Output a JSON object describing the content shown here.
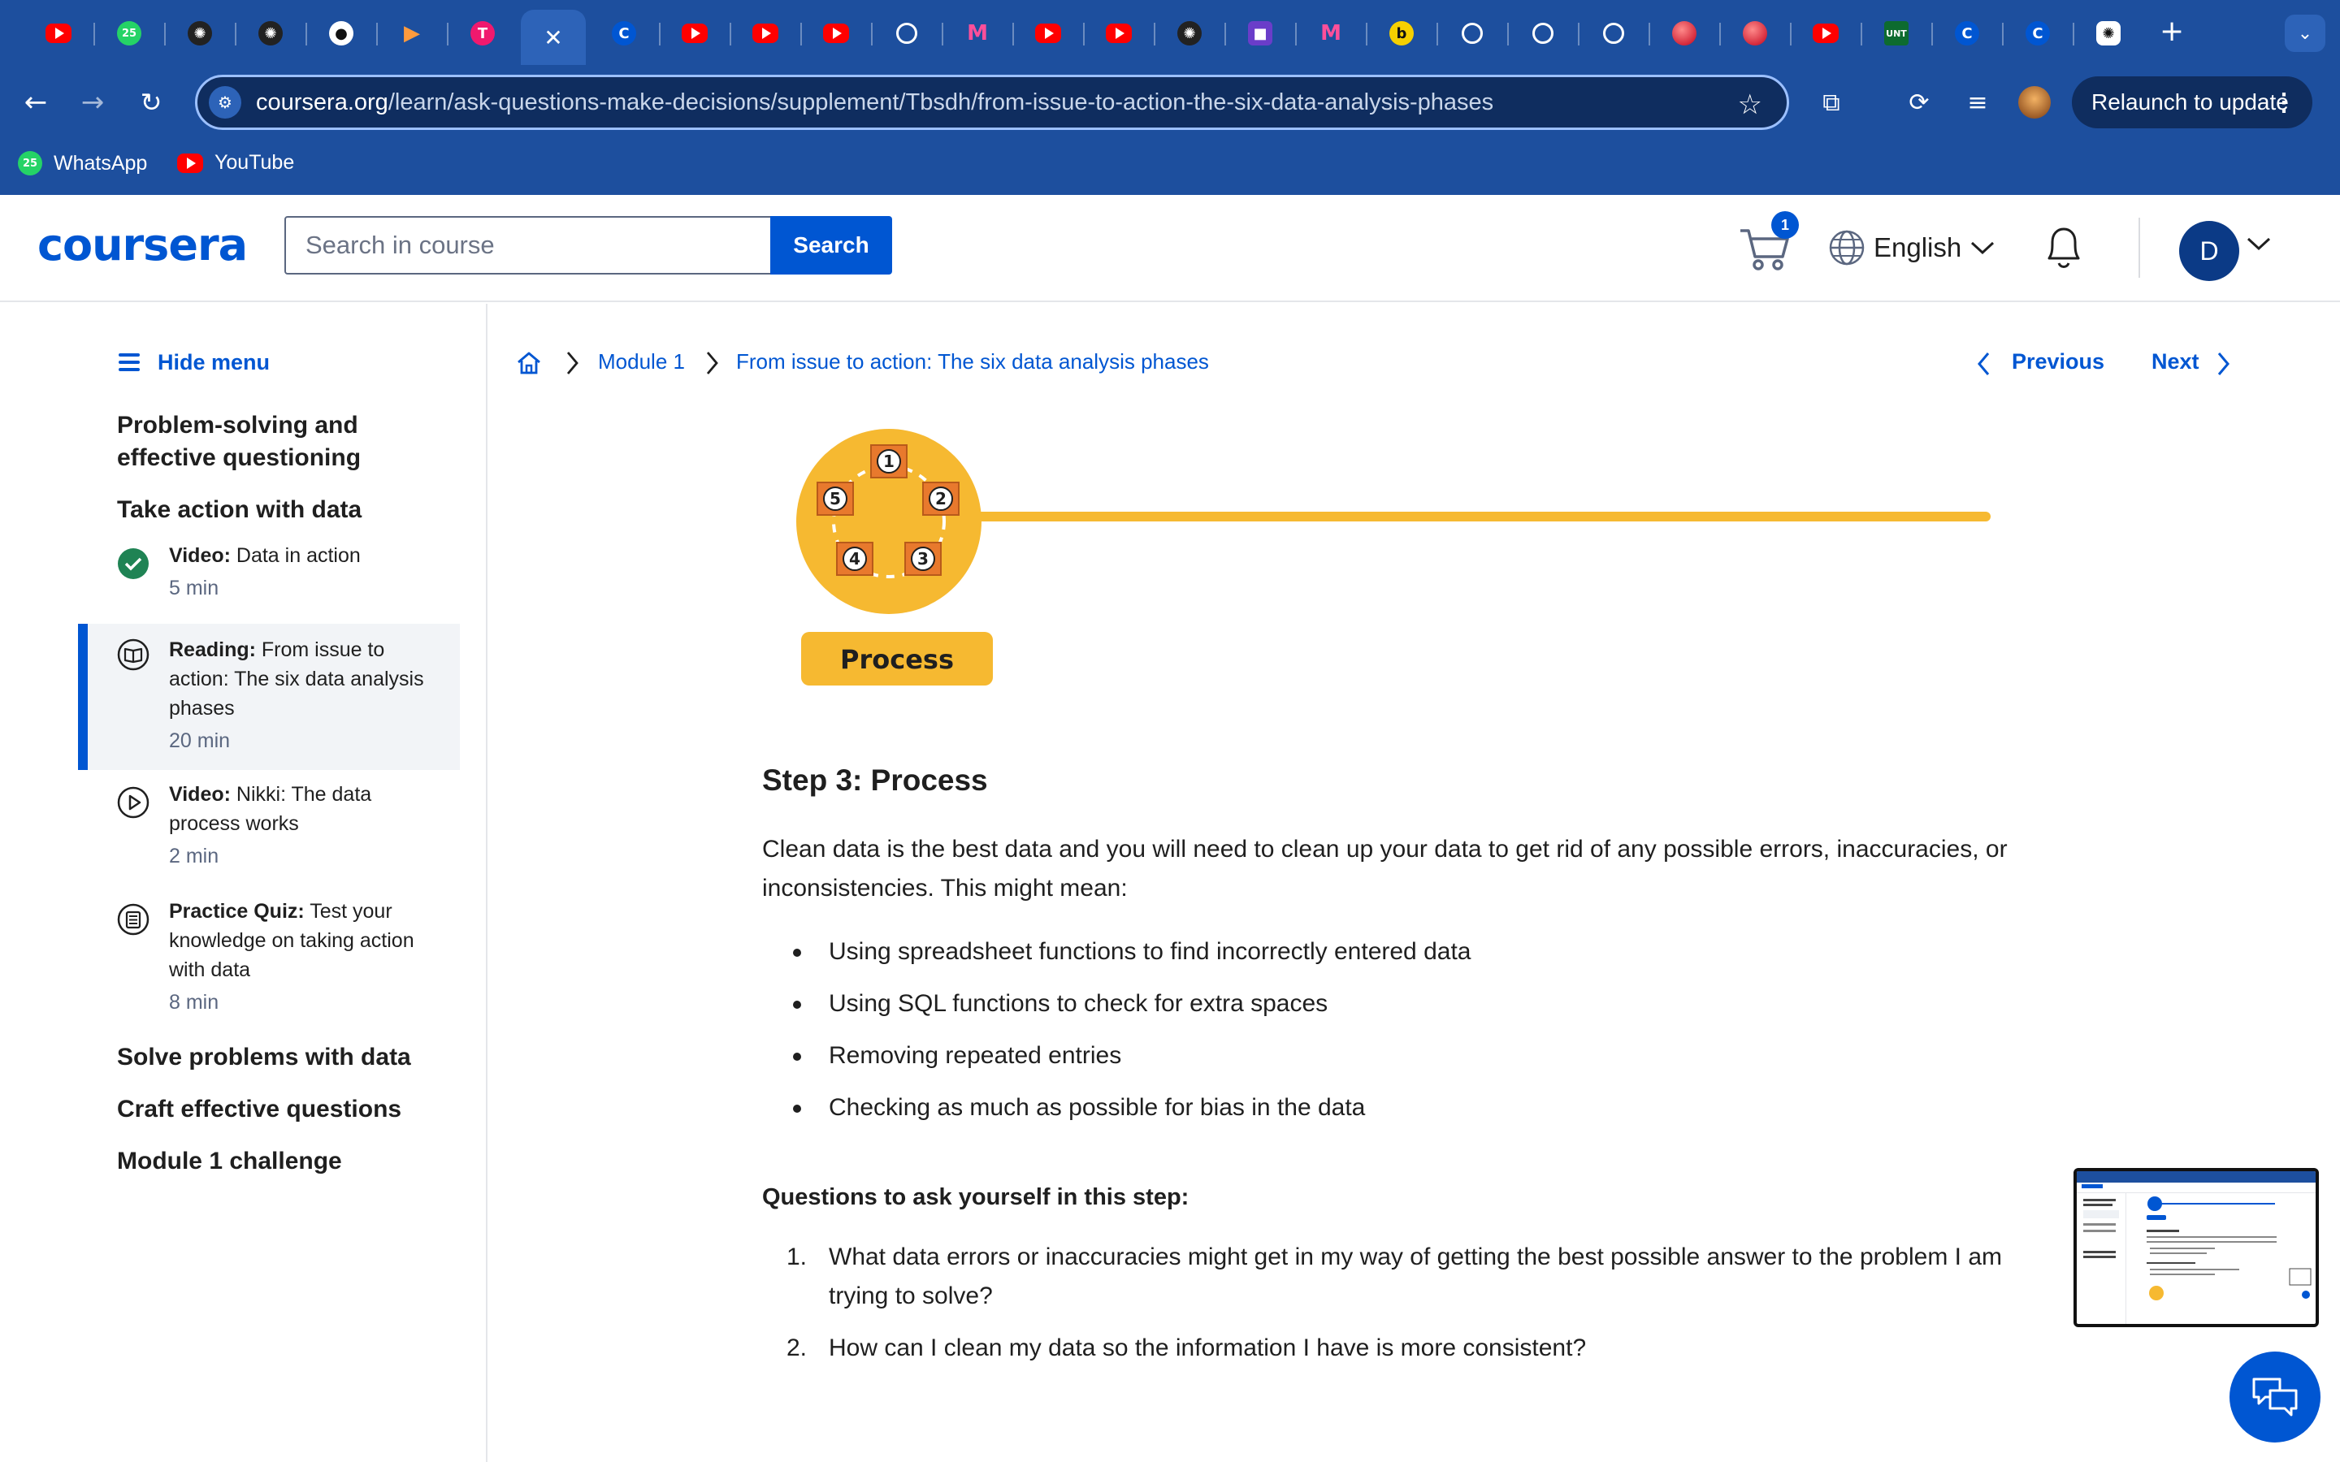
{
  "browser": {
    "tabs": [
      {
        "icon": "youtube-icon",
        "kind": "yt",
        "glyph": ""
      },
      {
        "icon": "whatsapp-icon",
        "kind": "wa",
        "glyph": "25"
      },
      {
        "icon": "openai-icon",
        "kind": "dark",
        "glyph": "✺"
      },
      {
        "icon": "openai-icon",
        "kind": "dark",
        "glyph": "✺"
      },
      {
        "icon": "github-icon",
        "kind": "gh",
        "glyph": "●"
      },
      {
        "icon": "play-icon",
        "kind": "play",
        "glyph": "▶"
      },
      {
        "icon": "tool-icon",
        "kind": "pink",
        "glyph": "T"
      },
      {
        "icon": "close-icon",
        "kind": "x",
        "glyph": "✕"
      },
      {
        "icon": "coursera-icon",
        "kind": "c",
        "glyph": "C"
      },
      {
        "icon": "youtube-icon",
        "kind": "yt",
        "glyph": ""
      },
      {
        "icon": "youtube-icon",
        "kind": "yt",
        "glyph": ""
      },
      {
        "icon": "youtube-icon",
        "kind": "yt",
        "glyph": ""
      },
      {
        "icon": "perplexity-icon",
        "kind": "circ",
        "glyph": ""
      },
      {
        "icon": "m-icon",
        "kind": "m",
        "glyph": "M"
      },
      {
        "icon": "youtube-icon",
        "kind": "yt",
        "glyph": ""
      },
      {
        "icon": "youtube-icon",
        "kind": "yt",
        "glyph": ""
      },
      {
        "icon": "openai-icon",
        "kind": "dark",
        "glyph": "✺"
      },
      {
        "icon": "camera-icon",
        "kind": "cam",
        "glyph": "■"
      },
      {
        "icon": "m-icon",
        "kind": "m",
        "glyph": "M"
      },
      {
        "icon": "bee-icon",
        "kind": "bee",
        "glyph": "b"
      },
      {
        "icon": "target-icon",
        "kind": "circ",
        "glyph": ""
      },
      {
        "icon": "target-icon",
        "kind": "circ",
        "glyph": ""
      },
      {
        "icon": "gauge-icon",
        "kind": "circ",
        "glyph": ""
      },
      {
        "icon": "ball-icon",
        "kind": "red",
        "glyph": ""
      },
      {
        "icon": "ball-icon",
        "kind": "red",
        "glyph": ""
      },
      {
        "icon": "youtube-icon",
        "kind": "yt",
        "glyph": ""
      },
      {
        "icon": "unt-icon",
        "kind": "unt",
        "glyph": "UNT"
      },
      {
        "icon": "coursera-icon",
        "kind": "c",
        "glyph": "C"
      },
      {
        "icon": "coursera-icon",
        "kind": "c",
        "glyph": "C"
      },
      {
        "icon": "chatgpt-icon",
        "kind": "gpt",
        "glyph": "✺"
      }
    ],
    "url_domain": "coursera.org",
    "url_path": "/learn/ask-questions-make-decisions/supplement/Tbsdh/from-issue-to-action-the-six-data-analysis-phases",
    "relaunch_label": "Relaunch to update",
    "bookmarks": [
      {
        "label": "WhatsApp",
        "icon": "whatsapp-icon"
      },
      {
        "label": "YouTube",
        "icon": "youtube-icon"
      }
    ]
  },
  "header": {
    "logo": "coursera",
    "search_placeholder": "Search in course",
    "search_button": "Search",
    "cart_count": "1",
    "language": "English",
    "avatar_initial": "D"
  },
  "sidebar": {
    "hide_menu": "Hide menu",
    "sections": [
      "Problem-solving and effective questioning",
      "Take action with data"
    ],
    "items": [
      {
        "type": "Video:",
        "title": "Data in action",
        "duration": "5 min",
        "icon": "check-circle-icon",
        "active": false
      },
      {
        "type": "Reading:",
        "title": "From issue to action: The six data analysis phases",
        "duration": "20 min",
        "icon": "book-icon",
        "active": true
      },
      {
        "type": "Video:",
        "title": "Nikki: The data process works",
        "duration": "2 min",
        "icon": "play-circle-icon",
        "active": false
      },
      {
        "type": "Practice Quiz:",
        "title": "Test your knowledge on taking action with data",
        "duration": "8 min",
        "icon": "quiz-icon",
        "active": false
      }
    ],
    "more_sections": [
      "Solve problems with data",
      "Craft effective questions",
      "Module 1 challenge"
    ]
  },
  "breadcrumb": {
    "module": "Module 1",
    "page": "From issue to action: The six data analysis phases"
  },
  "pager": {
    "previous": "Previous",
    "next": "Next"
  },
  "hero": {
    "label": "Process",
    "numbers": [
      "1",
      "2",
      "3",
      "4",
      "5"
    ],
    "accent": "#f6b931"
  },
  "content": {
    "heading": "Step 3: Process",
    "paragraph": "Clean data is the best data and you will need to clean up your data to get rid of any possible errors, inaccuracies, or inconsistencies. This might mean:",
    "bullets": [
      "Using spreadsheet functions to find incorrectly entered data",
      "Using SQL functions to check for extra spaces",
      "Removing repeated entries",
      "Checking as much as possible for bias in the data"
    ],
    "questions_heading": "Questions to ask yourself in this step:",
    "questions": [
      {
        "num": "1.",
        "text": "What data errors or inaccuracies might get in my way of getting the best possible answer to the problem I am trying to solve?"
      },
      {
        "num": "2.",
        "text": "How can I clean my data so the information I have is more consistent?"
      }
    ]
  },
  "colors": {
    "brand": "#0056d2",
    "chrome": "#1d4f9e",
    "text": "#1f1f1f"
  }
}
